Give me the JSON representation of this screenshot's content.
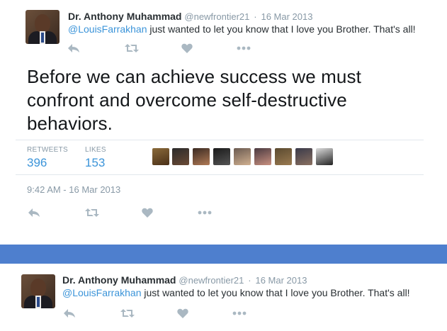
{
  "tweet_top": {
    "name": "Dr. Anthony Muhammad",
    "handle": "@newfrontier21",
    "separator": "·",
    "date": "16 Mar 2013",
    "mention": "@LouisFarrakhan",
    "text": " just wanted to let you know that I love you Brother. That's all!"
  },
  "main_tweet": {
    "text": "Before we can achieve success we must confront and overcome self-destructive behaviors.",
    "retweets_label": "RETWEETS",
    "retweets_count": "396",
    "likes_label": "LIKES",
    "likes_count": "153",
    "timestamp": "9:42 AM - 16 Mar 2013"
  },
  "tweet_bottom": {
    "name": "Dr. Anthony Muhammad",
    "handle": "@newfrontier21",
    "separator": "·",
    "date": "16 Mar 2013",
    "mention": "@LouisFarrakhan",
    "text": " just wanted to let you know that I love you Brother. That's all!"
  },
  "icons": {
    "reply": "reply-icon",
    "retweet": "retweet-icon",
    "like": "heart-icon",
    "more": "more-icon"
  },
  "colors": {
    "link": "#3b94d9",
    "muted": "#8899a6",
    "band": "#4e7fce"
  }
}
